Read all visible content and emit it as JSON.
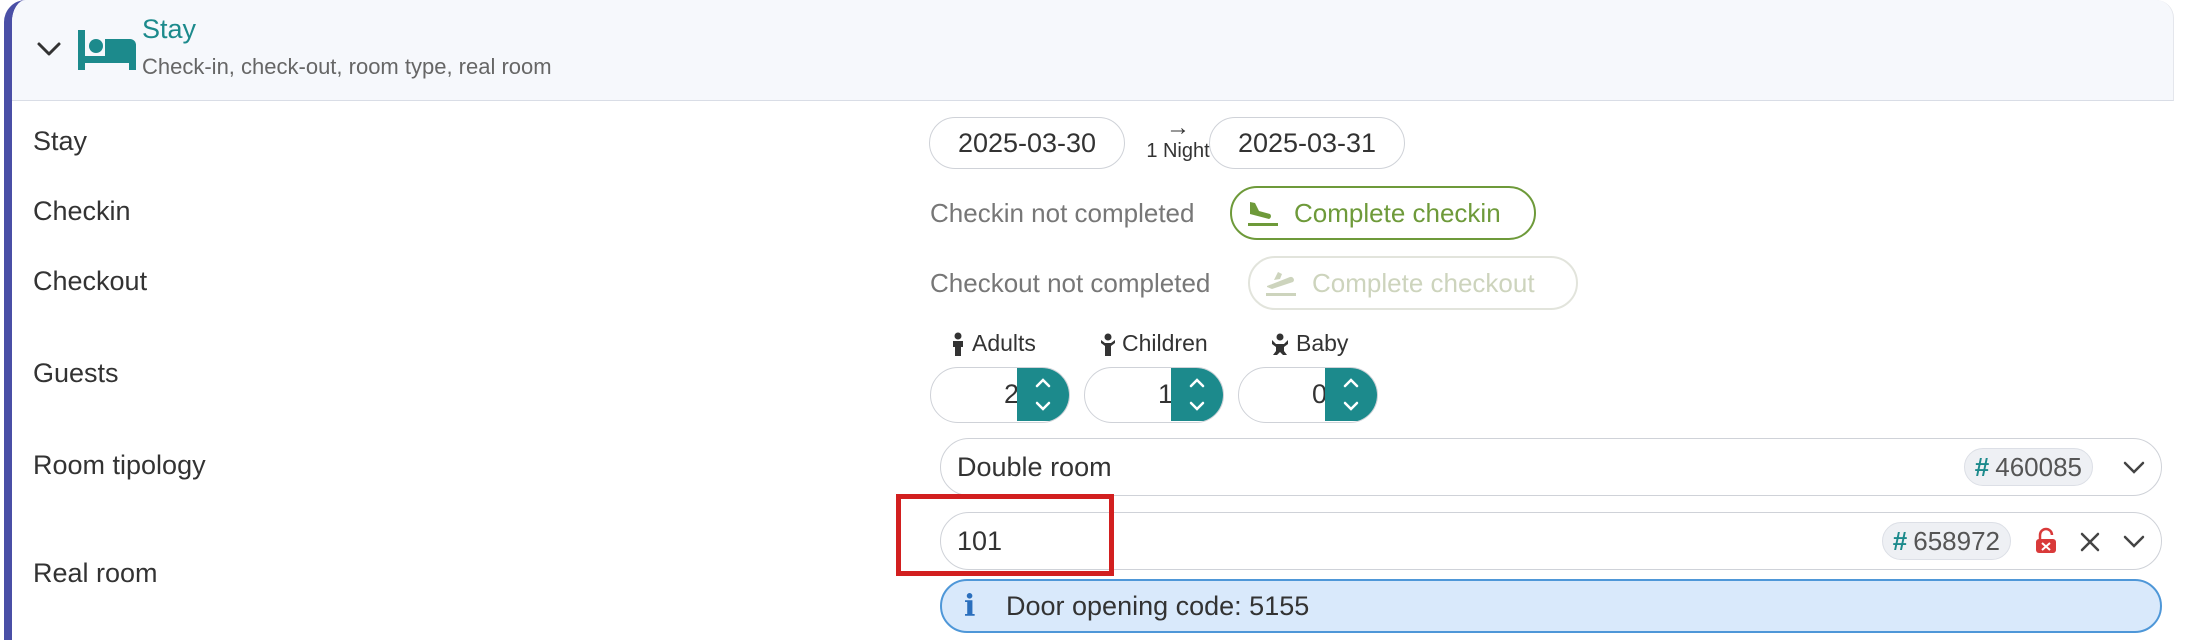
{
  "header": {
    "title": "Stay",
    "subtitle": "Check-in, check-out, room type, real room"
  },
  "rows": {
    "stay_label": "Stay",
    "checkin_label": "Checkin",
    "checkout_label": "Checkout",
    "guests_label": "Guests",
    "room_typology_label": "Room tipology",
    "real_room_label": "Real room"
  },
  "stay": {
    "checkin_date": "2025-03-30",
    "checkout_date": "2025-03-31",
    "nights": "1 Night"
  },
  "checkin": {
    "status": "Checkin not completed",
    "button": "Complete checkin"
  },
  "checkout": {
    "status": "Checkout not completed",
    "button": "Complete checkout"
  },
  "guests": {
    "adults_label": "Adults",
    "adults": "2",
    "children_label": "Children",
    "children": "1",
    "baby_label": "Baby",
    "baby": "0"
  },
  "room_typology": {
    "value": "Double room",
    "id": "460085"
  },
  "real_room": {
    "value": "101",
    "id": "658972",
    "info": "Door opening code: 5155"
  },
  "colors": {
    "accent": "#1c8a8c",
    "panel_border": "#4a4fa6",
    "checkin_green": "#6e9a3a",
    "info_bg": "#d9e9fb",
    "highlight": "#d21f1f"
  }
}
